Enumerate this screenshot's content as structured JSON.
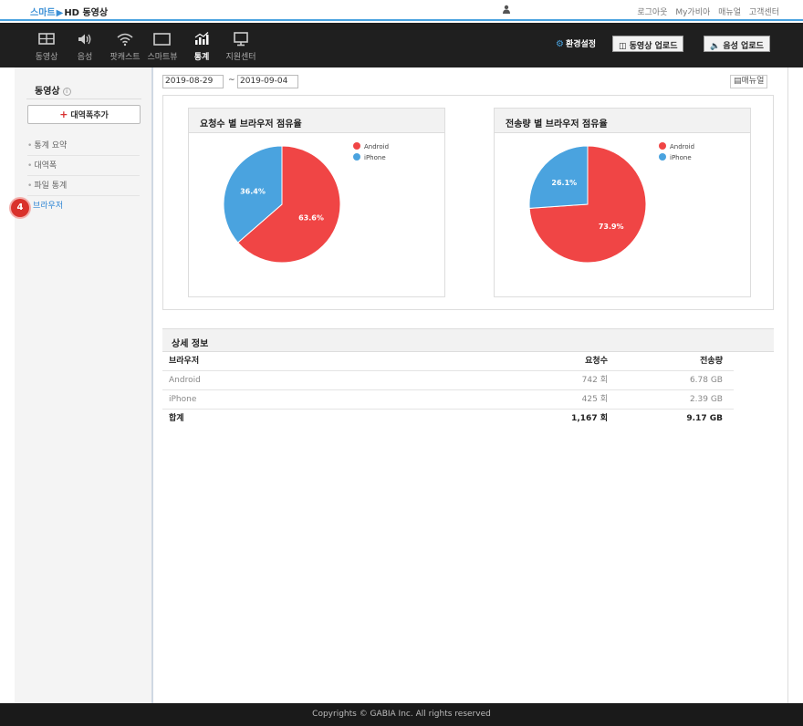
{
  "header": {
    "logo_part1": "스마트",
    "logo_part2": "HD 동영상",
    "links": [
      "로그아웃",
      "My가비아",
      "매뉴얼",
      "고객센터"
    ]
  },
  "nav": {
    "items": [
      {
        "label": "동영상",
        "icon": "film-icon"
      },
      {
        "label": "음성",
        "icon": "speaker-icon"
      },
      {
        "label": "팟캐스트",
        "icon": "wifi-icon"
      },
      {
        "label": "스마트뷰",
        "icon": "screen-icon"
      },
      {
        "label": "통계",
        "icon": "stats-icon",
        "active": true
      },
      {
        "label": "지원센터",
        "icon": "monitor-icon"
      }
    ],
    "settings_label": "환경설정",
    "video_upload_label": "동영상 업로드",
    "audio_upload_label": "음성 업로드"
  },
  "sidebar": {
    "title": "동영상",
    "add_button": "대역폭추가",
    "items": [
      {
        "label": "통계 요약"
      },
      {
        "label": "대역폭"
      },
      {
        "label": "파일 통계"
      },
      {
        "label": "브라우저",
        "active": true
      }
    ],
    "step_badge": "4"
  },
  "filter": {
    "start_date": "2019-08-29",
    "tilde": "~",
    "end_date": "2019-09-04",
    "manual_label": "매뉴얼"
  },
  "chart_data": [
    {
      "type": "pie",
      "title": "요청수 별 브라우저 점유율",
      "labels": [
        "Android",
        "iPhone"
      ],
      "values": [
        63.6,
        36.4
      ],
      "value_labels": [
        "63.6%",
        "36.4%"
      ],
      "colors": [
        "#f04545",
        "#4aa3df"
      ],
      "legend": "top-right"
    },
    {
      "type": "pie",
      "title": "전송량 별 브라우저 점유율",
      "labels": [
        "Android",
        "iPhone"
      ],
      "values": [
        73.9,
        26.1
      ],
      "value_labels": [
        "73.9%",
        "26.1%"
      ],
      "colors": [
        "#f04545",
        "#4aa3df"
      ],
      "legend": "top-right"
    }
  ],
  "detail": {
    "title": "상세 정보",
    "columns": [
      "브라우저",
      "요청수",
      "전송량"
    ],
    "rows": [
      [
        "Android",
        "742 회",
        "6.78 GB"
      ],
      [
        "iPhone",
        "425 회",
        "2.39 GB"
      ]
    ],
    "total": [
      "합계",
      "1,167 회",
      "9.17 GB"
    ]
  },
  "footer": {
    "text": "Copyrights © GABIA Inc. All rights reserved"
  }
}
